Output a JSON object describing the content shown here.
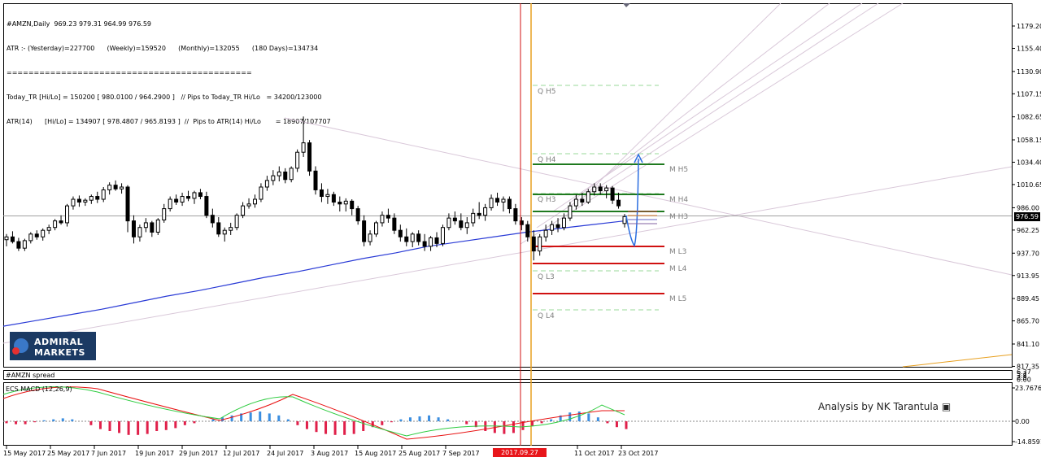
{
  "header": {
    "lines": [
      "#AMZN,Daily  969.23 979.31 964.99 976.59",
      "ATR :- (Yesterday)=227700      (Weekly)=159520      (Monthly)=132055      (180 Days)=134734",
      "=============================================",
      "Today_TR [Hi/Lo] = 150200 [ 980.0100 / 964.2900 ]   // Pips to Today_TR Hi/Lo   = 34200/123000",
      "ATR(14)      [Hi/Lo] = 134907 [ 978.4807 / 965.8193 ]  //  Pips to ATR(14) Hi/Lo       = 18907/107707"
    ]
  },
  "logo": {
    "line1": "ADMIRAL",
    "line2": "MARKETS"
  },
  "indicators": {
    "spread_label": "#AMZN spread",
    "macd_label": "ECS MACD (12,26,9)"
  },
  "annotation": "Analysis by NK Tarantula",
  "colors": {
    "bull": "#000000",
    "ma": "#2a3bd6",
    "red_line": "#d01010",
    "orange_line": "#e8a020",
    "green_level": "#1f7a1f",
    "red_level": "#d01010",
    "macd_pos": "#3b8ee0",
    "macd_neg": "#e0204a",
    "macd_signal_green": "#2ecc40",
    "macd_signal_red": "#e81010",
    "arrow": "#2a6de0"
  },
  "price_axis": {
    "ticks": [
      "1179.20",
      "1155.40",
      "1130.90",
      "1107.15",
      "1082.65",
      "1058.15",
      "1034.40",
      "1010.65",
      "986.00",
      "962.25",
      "937.70",
      "913.95",
      "889.45",
      "865.70",
      "841.10",
      "817.35"
    ],
    "current": "976.59"
  },
  "spread_axis": {
    "ticks": [
      "6.37",
      "5.1",
      "3.8",
      "2.5",
      "0.00"
    ]
  },
  "macd_axis": {
    "ticks": [
      "23.7676",
      "0.00",
      "-14.8591"
    ]
  },
  "time_axis": {
    "labels": [
      "15 May 2017",
      "25 May 2017",
      "7 Jun 2017",
      "19 Jun 2017",
      "29 Jun 2017",
      "12 Jul 2017",
      "24 Jul 2017",
      "3 Aug 2017",
      "15 Aug 2017",
      "25 Aug 2017",
      "7 Sep 2017",
      "",
      "",
      "11 Oct 2017",
      "23 Oct 2017"
    ],
    "highlight": "2017.09.27 00:00"
  },
  "levels": {
    "quarter": [
      "Q  H5",
      "Q  H4",
      "Q  H3",
      "Q  L3",
      "Q  L4"
    ],
    "monthly": [
      "M  H5",
      "M  H4",
      "M  H3",
      "M  L3",
      "M  L4",
      "M  L5"
    ]
  },
  "chart_data": {
    "type": "candlestick",
    "symbol": "#AMZN",
    "timeframe": "Daily",
    "last_bar": {
      "open": 969.23,
      "high": 979.31,
      "low": 964.99,
      "close": 976.59
    },
    "ylim": [
      817.35,
      1190
    ],
    "candles": [
      [
        952,
        958,
        945,
        955
      ],
      [
        955,
        961,
        948,
        950
      ],
      [
        950,
        954,
        940,
        943
      ],
      [
        943,
        953,
        940,
        951
      ],
      [
        951,
        960,
        948,
        958
      ],
      [
        958,
        962,
        952,
        955
      ],
      [
        955,
        964,
        951,
        962
      ],
      [
        962,
        968,
        958,
        965
      ],
      [
        965,
        974,
        962,
        972
      ],
      [
        972,
        978,
        968,
        970
      ],
      [
        970,
        990,
        966,
        988
      ],
      [
        988,
        998,
        984,
        995
      ],
      [
        995,
        999,
        987,
        992
      ],
      [
        992,
        996,
        988,
        994
      ],
      [
        994,
        1000,
        990,
        998
      ],
      [
        998,
        1003,
        991,
        995
      ],
      [
        995,
        1008,
        992,
        1005
      ],
      [
        1005,
        1013,
        1000,
        1010
      ],
      [
        1010,
        1015,
        1004,
        1006
      ],
      [
        1006,
        1012,
        1001,
        1008
      ],
      [
        1008,
        1010,
        960,
        972
      ],
      [
        972,
        978,
        948,
        955
      ],
      [
        955,
        968,
        950,
        965
      ],
      [
        965,
        975,
        960,
        970
      ],
      [
        970,
        972,
        955,
        960
      ],
      [
        960,
        975,
        957,
        973
      ],
      [
        973,
        990,
        970,
        985
      ],
      [
        985,
        998,
        982,
        995
      ],
      [
        995,
        1000,
        989,
        992
      ],
      [
        992,
        1002,
        988,
        998
      ],
      [
        998,
        1004,
        993,
        996
      ],
      [
        996,
        1004,
        990,
        1002
      ],
      [
        1002,
        1006,
        995,
        998
      ],
      [
        998,
        1003,
        975,
        978
      ],
      [
        978,
        985,
        965,
        970
      ],
      [
        970,
        976,
        955,
        958
      ],
      [
        958,
        965,
        950,
        962
      ],
      [
        962,
        970,
        957,
        965
      ],
      [
        965,
        980,
        962,
        978
      ],
      [
        978,
        992,
        975,
        988
      ],
      [
        988,
        996,
        985,
        990
      ],
      [
        990,
        1000,
        986,
        995
      ],
      [
        995,
        1012,
        992,
        1008
      ],
      [
        1008,
        1020,
        1004,
        1015
      ],
      [
        1015,
        1026,
        1010,
        1020
      ],
      [
        1020,
        1030,
        1014,
        1024
      ],
      [
        1024,
        1028,
        1012,
        1016
      ],
      [
        1016,
        1030,
        1013,
        1028
      ],
      [
        1028,
        1048,
        1024,
        1045
      ],
      [
        1045,
        1083,
        1040,
        1055
      ],
      [
        1055,
        1058,
        1020,
        1025
      ],
      [
        1025,
        1030,
        1000,
        1005
      ],
      [
        1005,
        1012,
        992,
        998
      ],
      [
        998,
        1006,
        990,
        1000
      ],
      [
        1000,
        1003,
        988,
        992
      ],
      [
        992,
        998,
        982,
        990
      ],
      [
        990,
        996,
        982,
        993
      ],
      [
        993,
        995,
        978,
        985
      ],
      [
        985,
        988,
        968,
        972
      ],
      [
        972,
        978,
        945,
        950
      ],
      [
        950,
        962,
        946,
        958
      ],
      [
        958,
        972,
        955,
        970
      ],
      [
        970,
        982,
        966,
        978
      ],
      [
        978,
        985,
        970,
        975
      ],
      [
        975,
        980,
        958,
        962
      ],
      [
        962,
        968,
        950,
        955
      ],
      [
        955,
        964,
        945,
        950
      ],
      [
        950,
        960,
        944,
        958
      ],
      [
        958,
        962,
        946,
        950
      ],
      [
        950,
        958,
        940,
        945
      ],
      [
        945,
        956,
        940,
        954
      ],
      [
        954,
        960,
        944,
        948
      ],
      [
        948,
        968,
        945,
        965
      ],
      [
        965,
        980,
        962,
        975
      ],
      [
        975,
        982,
        968,
        972
      ],
      [
        972,
        980,
        962,
        965
      ],
      [
        965,
        976,
        958,
        970
      ],
      [
        970,
        985,
        966,
        980
      ],
      [
        980,
        992,
        974,
        978
      ],
      [
        978,
        990,
        972,
        986
      ],
      [
        986,
        1000,
        983,
        996
      ],
      [
        996,
        1002,
        988,
        992
      ],
      [
        992,
        998,
        982,
        995
      ],
      [
        995,
        998,
        980,
        985
      ],
      [
        985,
        990,
        968,
        972
      ],
      [
        972,
        976,
        962,
        968
      ],
      [
        968,
        972,
        950,
        955
      ],
      [
        955,
        962,
        930,
        940
      ],
      [
        940,
        958,
        935,
        955
      ],
      [
        955,
        968,
        950,
        962
      ],
      [
        962,
        972,
        957,
        968
      ],
      [
        968,
        975,
        960,
        965
      ],
      [
        965,
        980,
        962,
        975
      ],
      [
        975,
        992,
        972,
        988
      ],
      [
        988,
        1000,
        984,
        995
      ],
      [
        995,
        1002,
        988,
        992
      ],
      [
        992,
        1006,
        990,
        1003
      ],
      [
        1003,
        1012,
        999,
        1008
      ],
      [
        1008,
        1012,
        1000,
        1004
      ],
      [
        1004,
        1010,
        996,
        1007
      ],
      [
        1007,
        1009,
        990,
        994
      ],
      [
        994,
        1002,
        985,
        988
      ],
      [
        969.23,
        979.31,
        964.99,
        976.59
      ]
    ],
    "series": [
      {
        "name": "MA",
        "values": [
          860,
          866,
          872,
          878,
          885,
          892,
          898,
          905,
          912,
          918,
          925,
          932,
          938,
          945,
          950,
          955,
          960,
          964,
          968,
          972
        ]
      }
    ]
  }
}
